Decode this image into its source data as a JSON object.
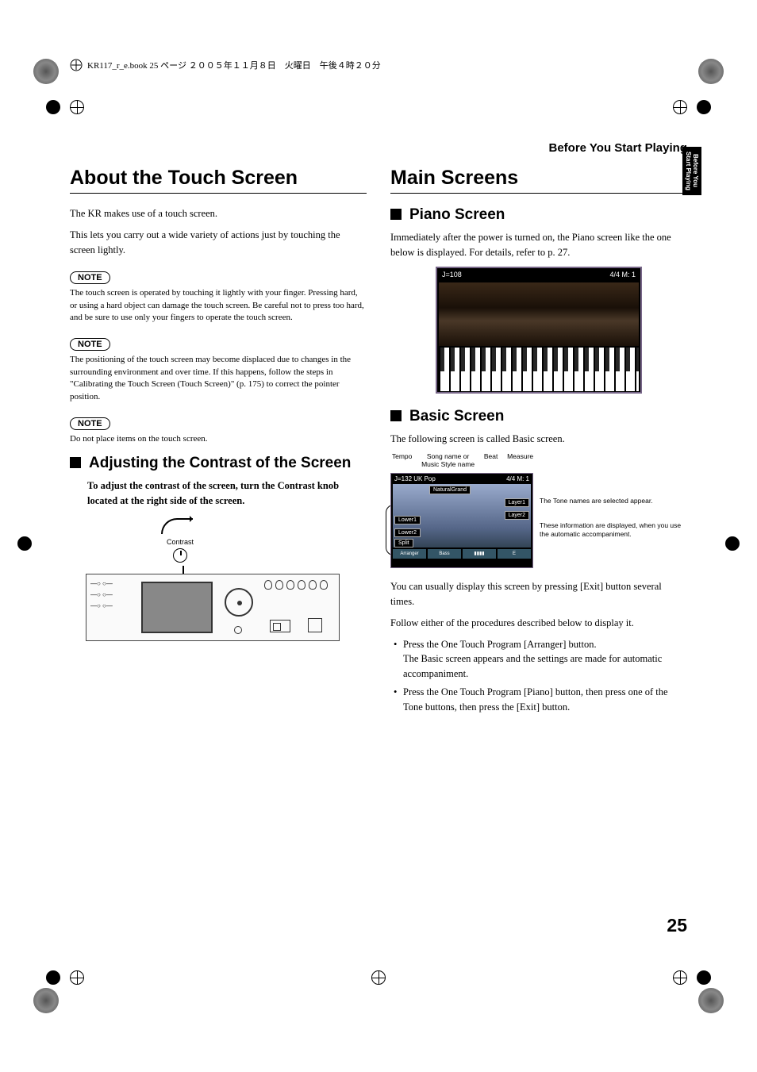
{
  "book_header": "KR117_r_e.book 25 ページ ２００５年１１月８日　火曜日　午後４時２０分",
  "running_head": "Before You Start Playing",
  "side_tab": "Before You\nStart Playing",
  "page_number": "25",
  "left": {
    "h1": "About the Touch Screen",
    "intro1": "The KR makes use of a touch screen.",
    "intro2": "This lets you carry out a wide variety of actions just by touching the screen lightly.",
    "note_label": "NOTE",
    "note1": "The touch screen is operated by touching it lightly with your finger. Pressing hard, or using a hard object can damage the touch screen. Be careful not to press too hard, and be sure to use only your fingers to operate the touch screen.",
    "note2": "The positioning of the touch screen may become displaced due to changes in the surrounding environment and over time. If this happens, follow the steps in \"Calibrating the Touch Screen (Touch Screen)\" (p. 175) to correct the pointer position.",
    "note3": "Do not place items on the touch screen.",
    "h2_contrast": "Adjusting the Contrast of the Screen",
    "contrast_instr": "To adjust the contrast of the screen, turn the Contrast knob located at the right side of the screen.",
    "contrast_label": "Contrast"
  },
  "right": {
    "h1": "Main Screens",
    "h2_piano": "Piano Screen",
    "piano_text": "Immediately after the power is turned on, the Piano screen like the one below is displayed. For details, refer to p. 27.",
    "piano_topbar_left": "J=108",
    "piano_topbar_right": "4/4   M:    1",
    "h2_basic": "Basic Screen",
    "basic_intro": "The following screen is called Basic screen.",
    "callouts": {
      "tempo": "Tempo",
      "song": "Song name or\nMusic Style name",
      "beat": "Beat",
      "measure": "Measure"
    },
    "basic_labels": {
      "topbar_left": "J=132 UK Pop",
      "topbar_right": "4/4  M:   1",
      "natural": "NaturalGrand",
      "layer1": "Layer1",
      "layer2": "Layer2",
      "lower1": "Lower1",
      "lower2": "Lower2",
      "split": "Split",
      "arranger": "Arranger",
      "bass": "Bass"
    },
    "callout_right1": "The Tone names are selected appear.",
    "callout_right2": "These information are displayed, when you use the automatic accompaniment.",
    "basic_p1": "You can usually display this screen by pressing [Exit] button several times.",
    "basic_p2": "Follow either of the procedures described below to display it.",
    "bullets": [
      {
        "a": "Press the One Touch Program [Arranger] button.",
        "b": "The Basic screen appears and the settings are made for automatic accompaniment."
      },
      {
        "a": "Press the One Touch Program [Piano] button, then press one of the Tone buttons, then press the [Exit] button.",
        "b": ""
      }
    ]
  }
}
